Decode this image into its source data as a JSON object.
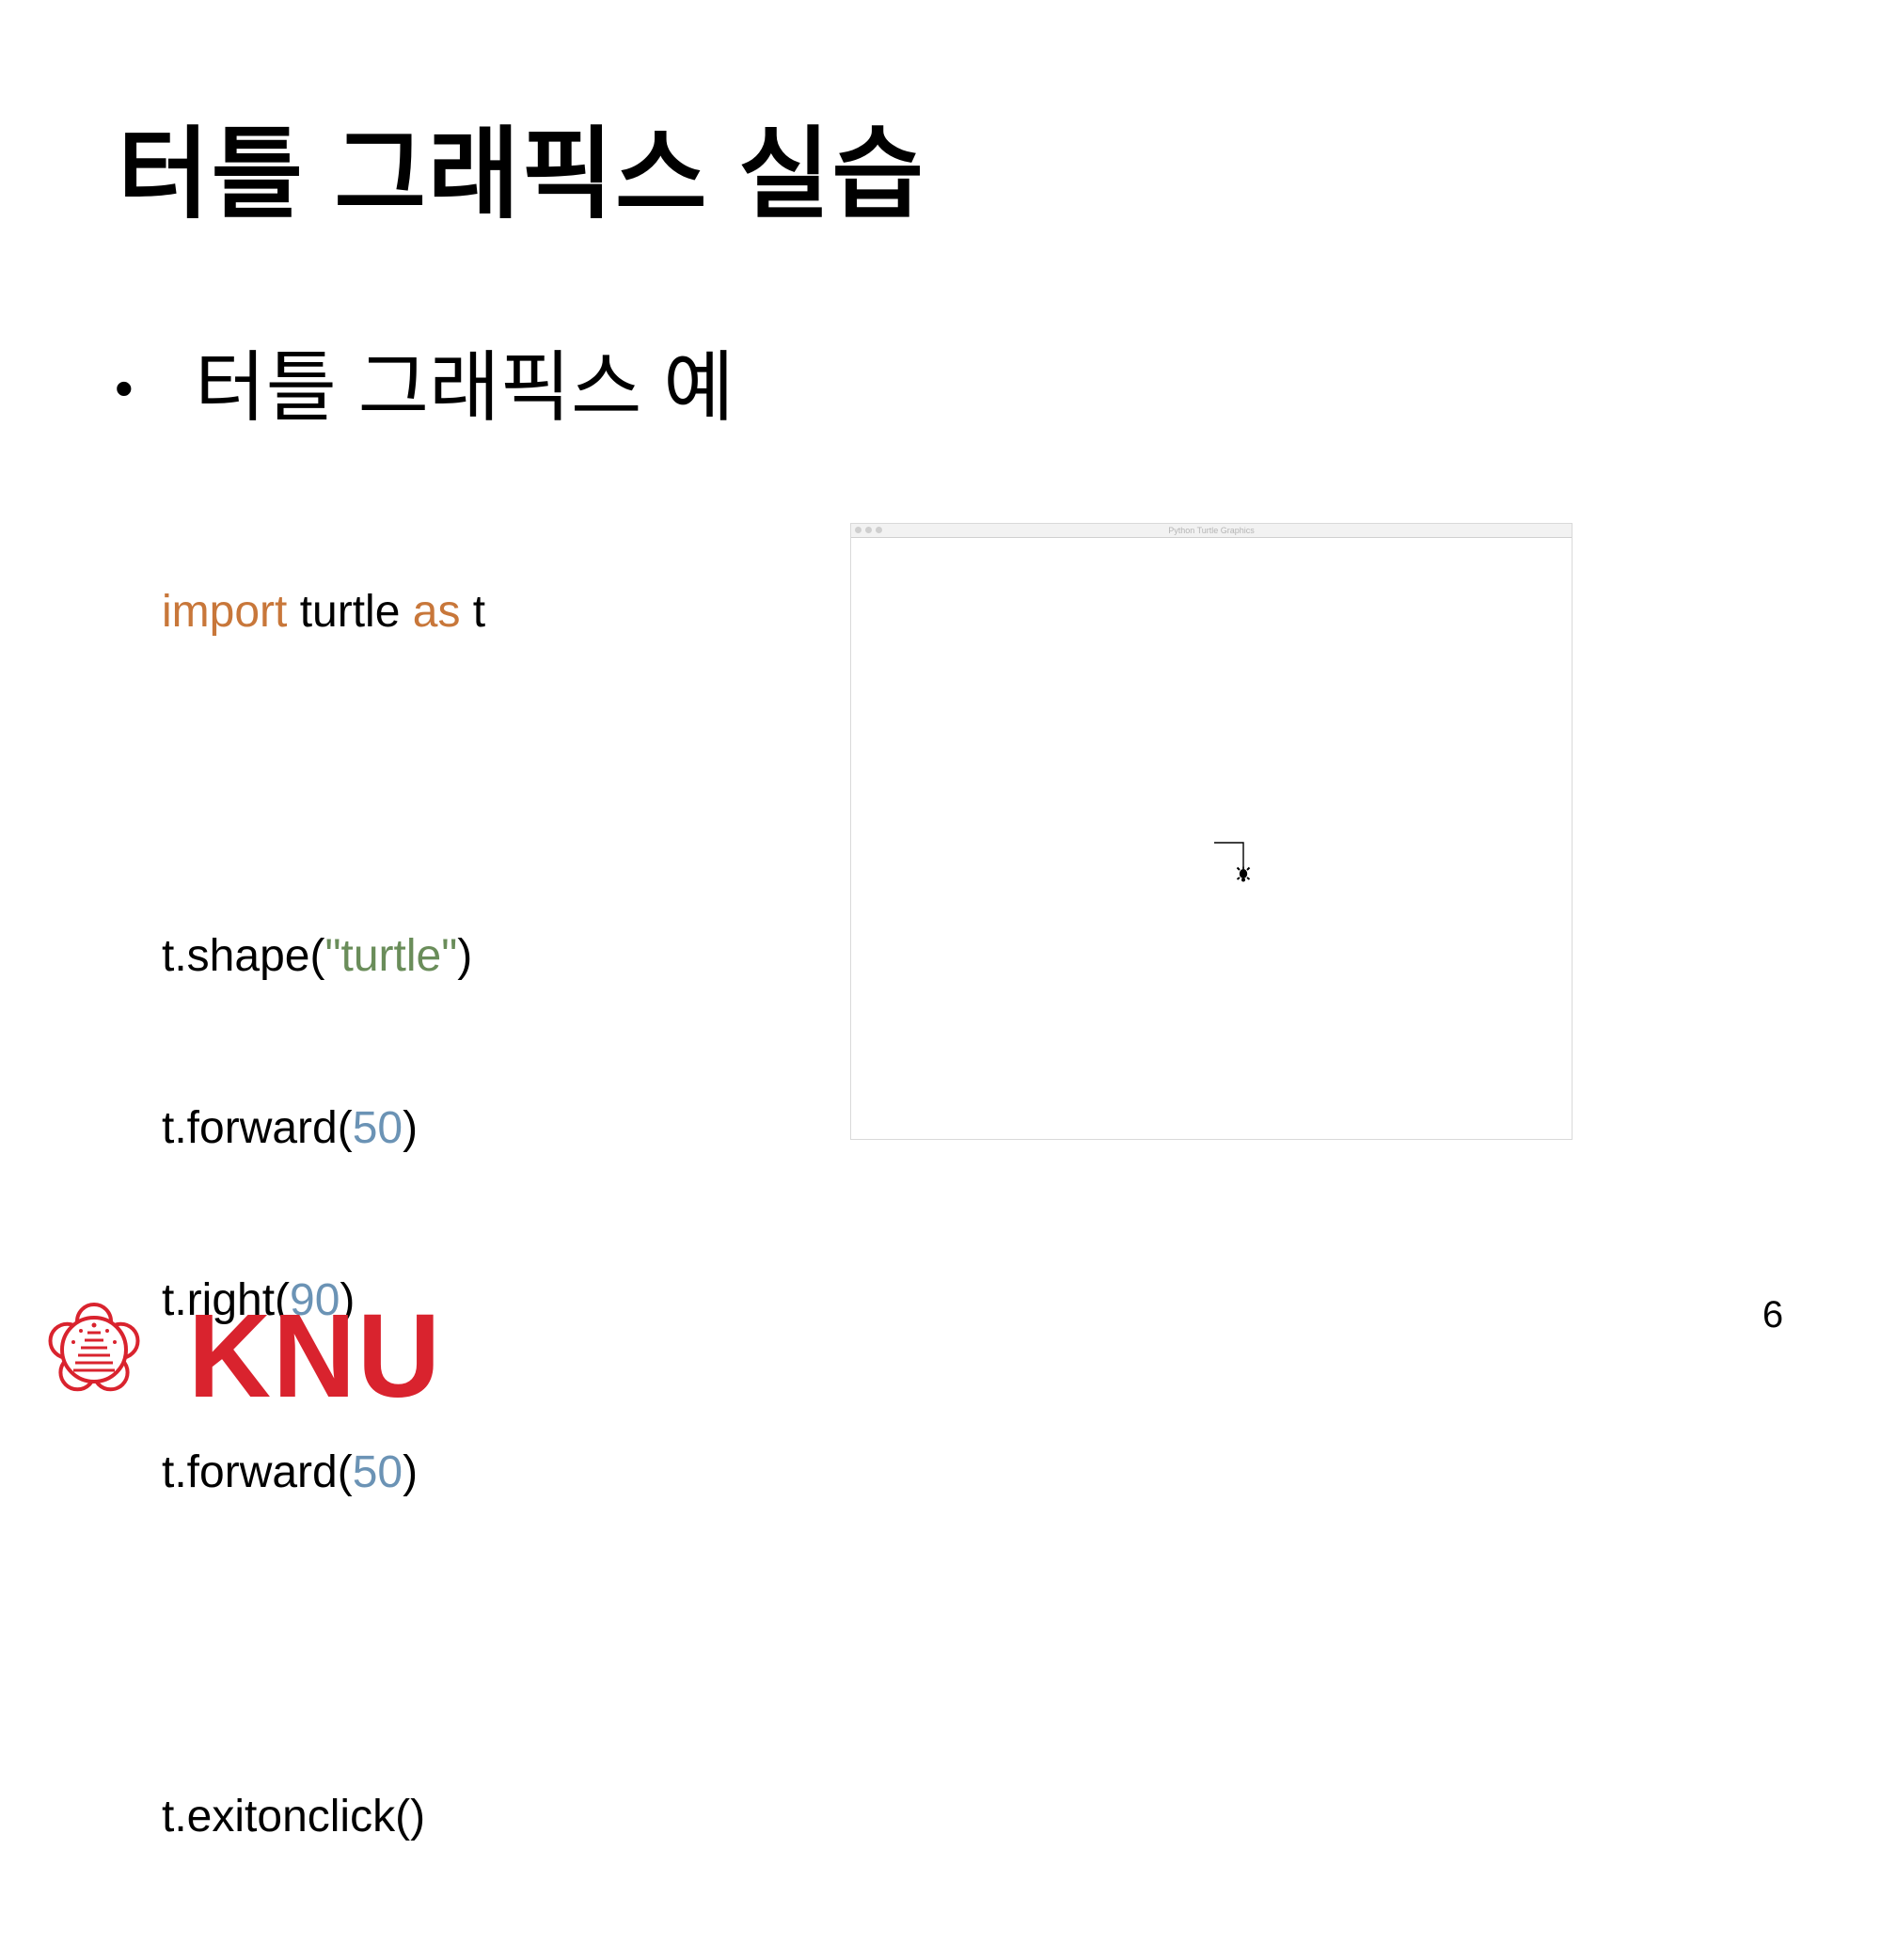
{
  "slide": {
    "title": "터틀 그래픽스 실습",
    "bullet": {
      "symbol": "•",
      "text": "터틀 그래픽스 예"
    },
    "code": {
      "line1": {
        "kw1": "import",
        "mid": " turtle ",
        "kw2": "as",
        "end": " t"
      },
      "line2": {
        "pre": "t.shape(",
        "str": "\"turtle\"",
        "post": ")"
      },
      "line3": {
        "pre": "t.forward(",
        "num": "50",
        "post": ")"
      },
      "line4": {
        "pre": "t.right(",
        "num": "90",
        "post": ")"
      },
      "line5": {
        "pre": "t.forward(",
        "num": "50",
        "post": ")"
      },
      "line6": {
        "text": "t.exitonclick()"
      }
    },
    "turtle_window": {
      "title": "Python Turtle Graphics",
      "turtle_path": {
        "forward_1": 50,
        "right_turn_degrees": 90,
        "forward_2": 50
      }
    },
    "page_number": "6",
    "logo": {
      "wordmark": "KNU",
      "icon": "knu-emblem-icon",
      "color": "#d9232e"
    },
    "colors": {
      "keyword": "#c8773a",
      "string": "#6a8d5a",
      "number": "#6b93b5"
    }
  }
}
